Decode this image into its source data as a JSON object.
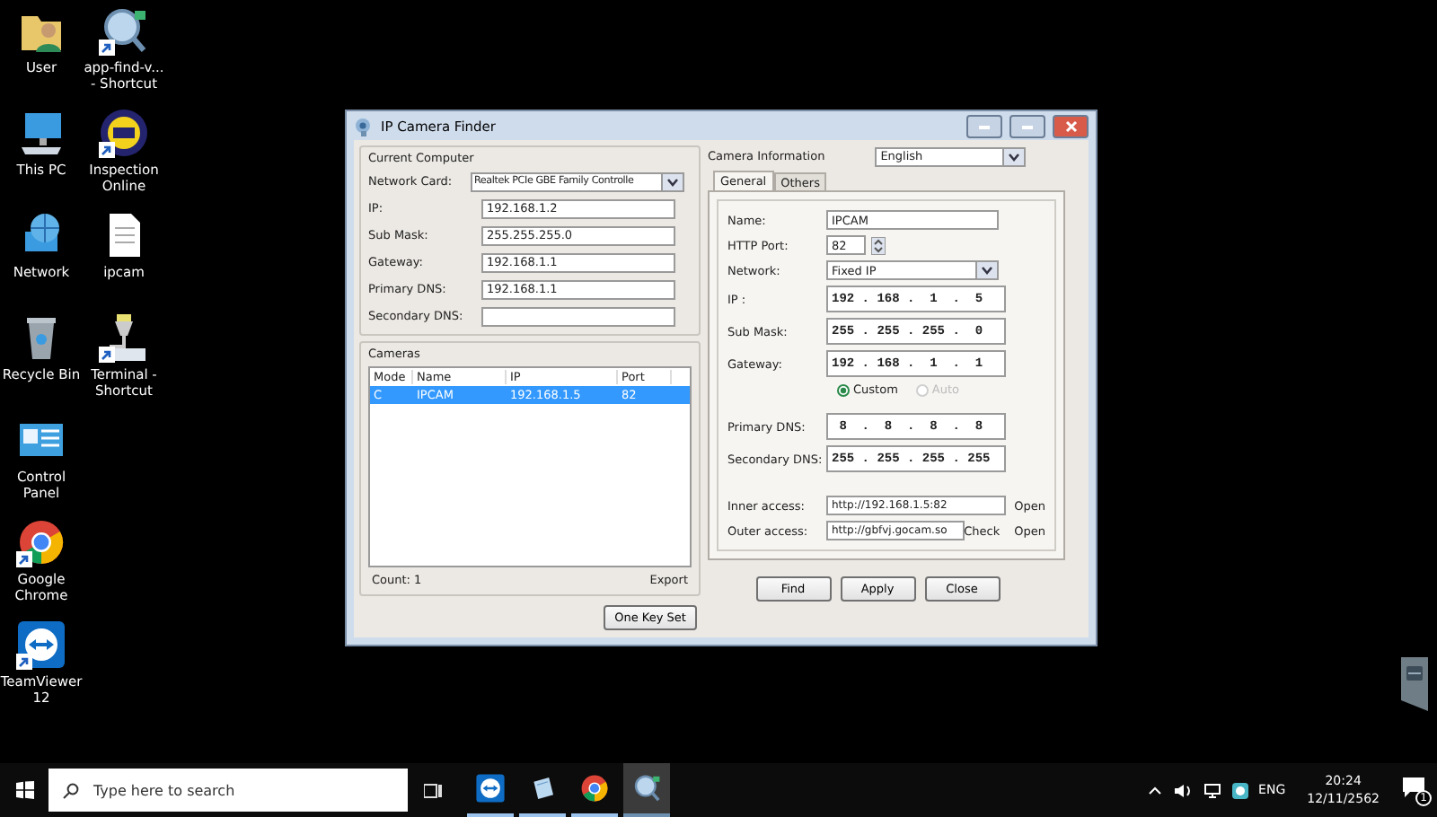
{
  "desktop_icons": [
    {
      "label": "User",
      "kind": "user-folder",
      "shortcut": false
    },
    {
      "label": "This PC",
      "kind": "computer",
      "shortcut": false
    },
    {
      "label": "Network",
      "kind": "network",
      "shortcut": false
    },
    {
      "label": "Recycle Bin",
      "kind": "recycle-bin",
      "shortcut": false
    },
    {
      "label": "Control Panel",
      "kind": "control-panel",
      "shortcut": false
    },
    {
      "label": "Google Chrome",
      "kind": "chrome",
      "shortcut": true
    },
    {
      "label": "TeamViewer 12",
      "kind": "teamviewer",
      "shortcut": true
    },
    {
      "label": "app-find-v... - Shortcut",
      "kind": "search-app",
      "shortcut": true
    },
    {
      "label": "Inspection Online",
      "kind": "inspection",
      "shortcut": true
    },
    {
      "label": "ipcam",
      "kind": "document",
      "shortcut": false
    },
    {
      "label": "Terminal - Shortcut",
      "kind": "terminal",
      "shortcut": true
    }
  ],
  "window": {
    "title": "IP Camera Finder",
    "current_computer": {
      "title": "Current Computer",
      "network_card": {
        "label": "Network Card:",
        "value": "Realtek PCIe GBE Family Controlle"
      },
      "fields": [
        {
          "label": "IP:",
          "value": "192.168.1.2"
        },
        {
          "label": "Sub Mask:",
          "value": "255.255.255.0"
        },
        {
          "label": "Gateway:",
          "value": "192.168.1.1"
        },
        {
          "label": "Primary DNS:",
          "value": "192.168.1.1"
        },
        {
          "label": "Secondary DNS:"
        }
      ]
    },
    "cameras": {
      "title": "Cameras",
      "columns": [
        "Mode",
        "Name",
        "IP",
        "Port"
      ],
      "rows": [
        {
          "cells": [
            "C",
            "IPCAM",
            "192.168.1.5",
            "82"
          ],
          "selected": true
        }
      ],
      "count": "Count: 1",
      "export": "Export"
    },
    "one_key_set": "One Key Set",
    "camera_information": {
      "title": "Camera Information",
      "language": "English",
      "tabs": [
        {
          "label": "General",
          "selected": true
        },
        {
          "label": "Others",
          "selected": false
        }
      ],
      "name": {
        "label": "Name:",
        "value": "IPCAM"
      },
      "http_port": {
        "label": "HTTP Port:",
        "value": "82"
      },
      "network": {
        "label": "Network:",
        "value": "Fixed IP"
      },
      "addresses": [
        {
          "label": "IP :",
          "value": "192 . 168 .  1  .  5"
        },
        {
          "label": "Sub Mask:",
          "value": "255 . 255 . 255 .  0"
        },
        {
          "label": "Gateway:",
          "value": "192 . 168 .  1  .  1"
        }
      ],
      "dns_modes": [
        {
          "label": "Custom",
          "selected": true,
          "disabled": false
        },
        {
          "label": "Auto",
          "selected": false,
          "disabled": true
        }
      ],
      "dns": [
        {
          "label": "Primary DNS:",
          "value": " 8  .  8  .  8  .  8"
        },
        {
          "label": "Secondary DNS:",
          "value": "255 . 255 . 255 . 255"
        }
      ],
      "inner_access": {
        "label": "Inner access:",
        "value": "http://192.168.1.5:82",
        "links": [
          "Open"
        ]
      },
      "outer_access": {
        "label": "Outer access:",
        "value": "http://gbfvj.gocam.so",
        "links": [
          "Check",
          "Open"
        ]
      }
    },
    "buttons": [
      "Find",
      "Apply",
      "Close"
    ]
  },
  "taskbar": {
    "search_placeholder": "Type here to search",
    "apps": [
      {
        "kind": "teamviewer",
        "active": false
      },
      {
        "kind": "notepad",
        "active": false
      },
      {
        "kind": "chrome",
        "active": false
      },
      {
        "kind": "search-app",
        "active": true
      }
    ],
    "language": "ENG",
    "time": "20:24",
    "date": "12/11/2562",
    "notifications": "1"
  }
}
